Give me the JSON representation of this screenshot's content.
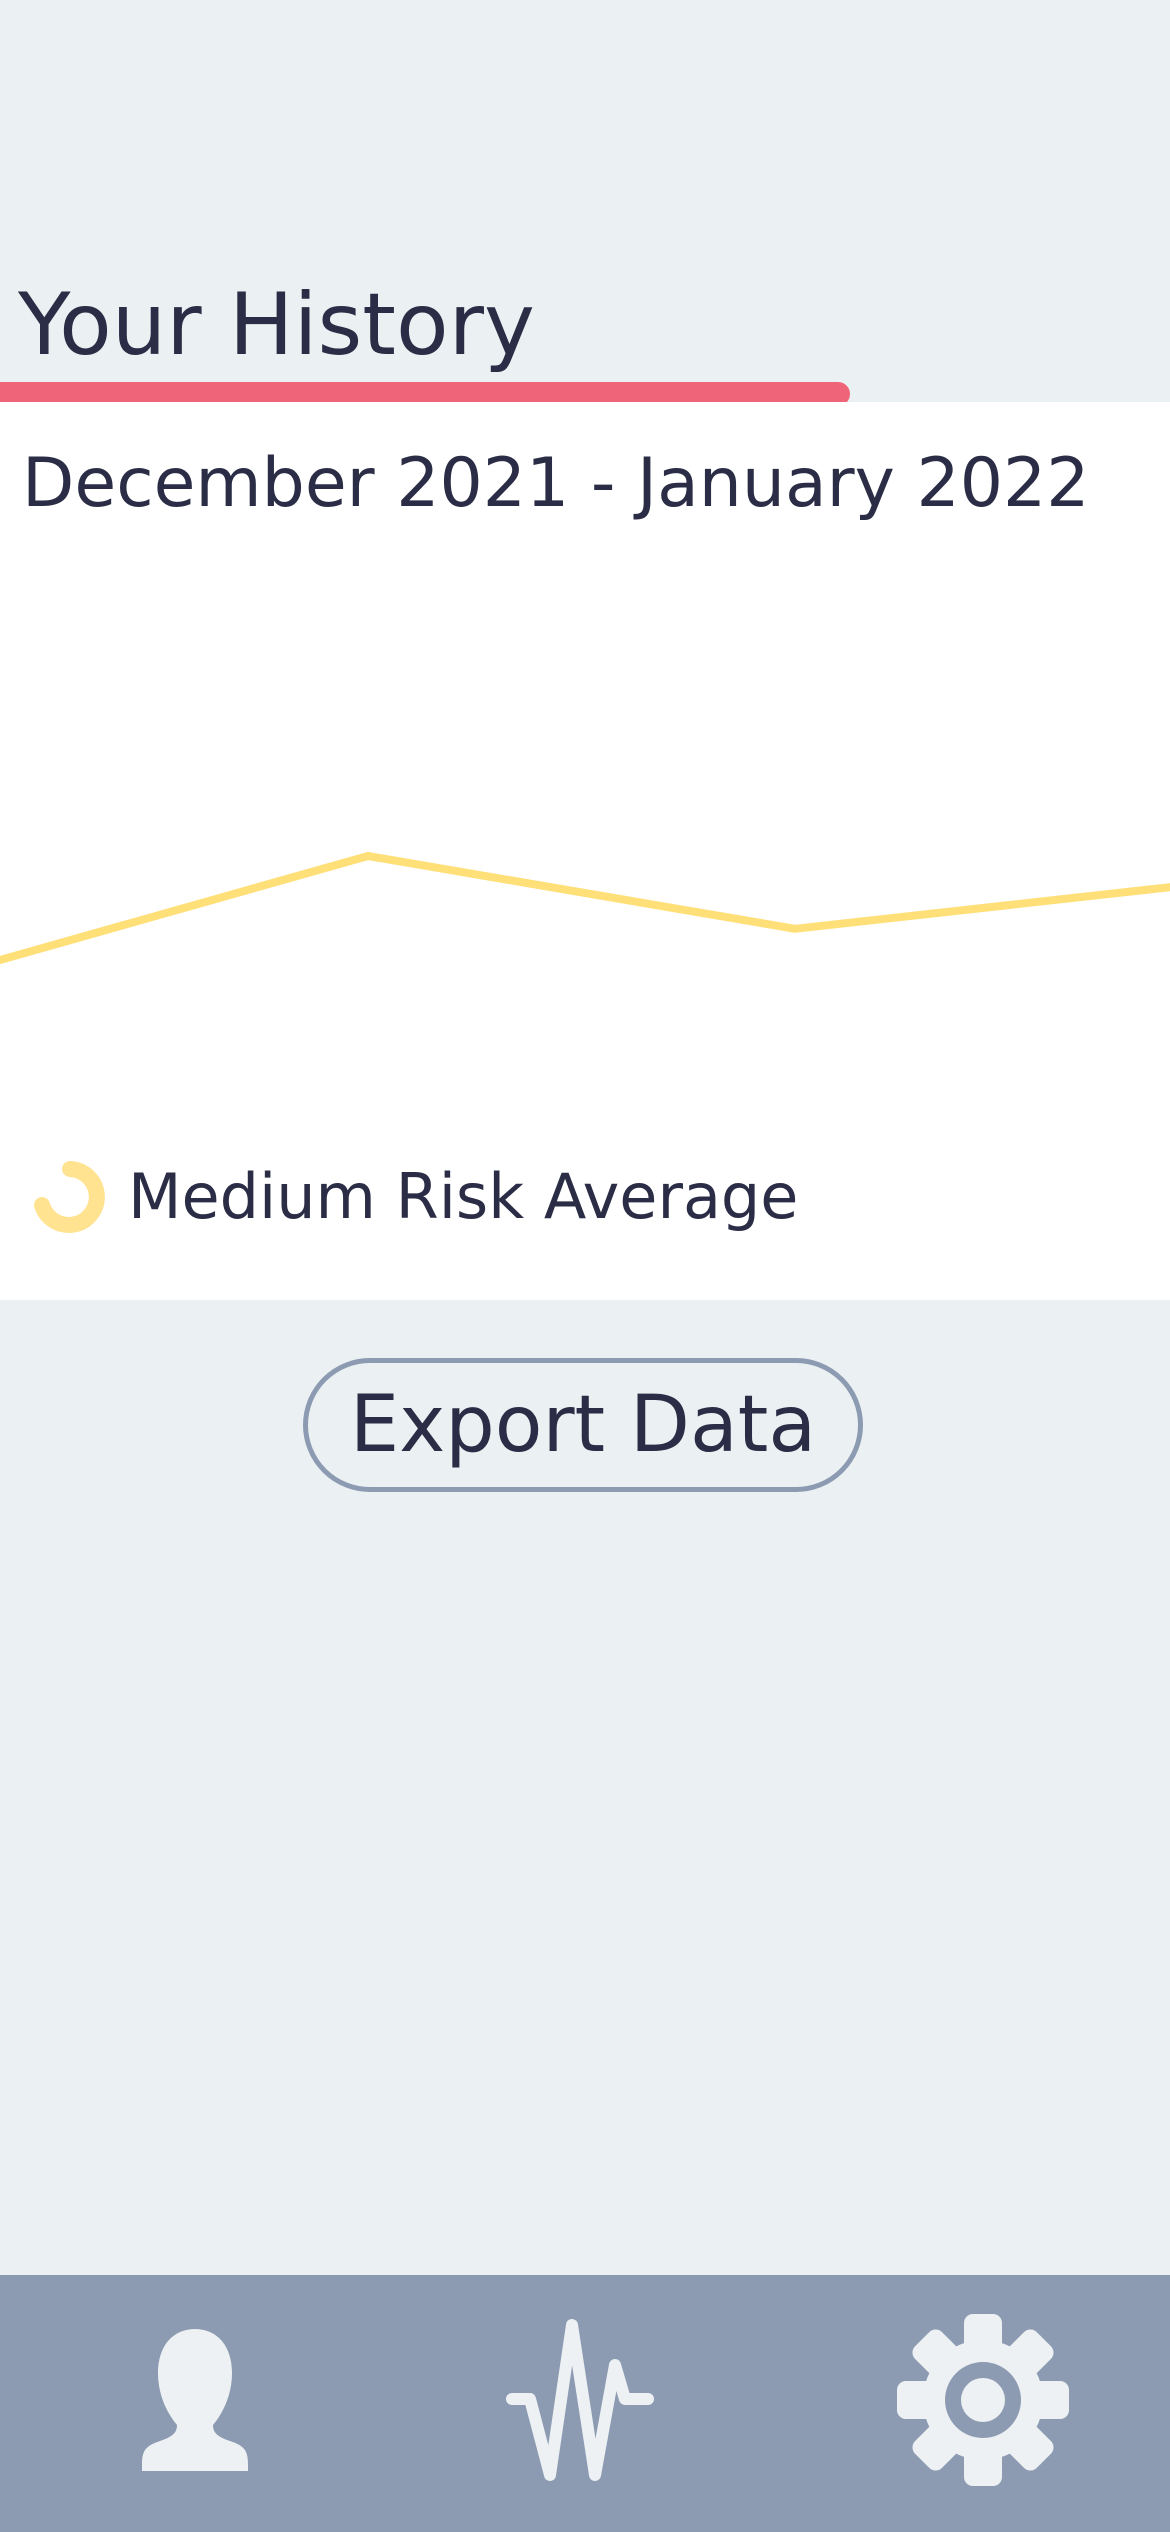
{
  "header": {
    "title": "Your History"
  },
  "history": {
    "date_range": "December 2021 - January 2022",
    "legend_label": "Medium Risk Average",
    "line_color": "#ffdf78"
  },
  "chart_data": {
    "type": "line",
    "series": [
      {
        "values": [
          0.2,
          0.6,
          0.32,
          0.48
        ]
      }
    ],
    "ylim": [
      0,
      1
    ],
    "grid": false
  },
  "actions": {
    "export_label": "Export Data"
  },
  "nav": {
    "items": [
      {
        "icon": "profile-icon"
      },
      {
        "icon": "activity-icon"
      },
      {
        "icon": "settings-icon"
      }
    ]
  },
  "colors": {
    "background": "#ebf0f3",
    "card": "#ffffff",
    "accent": "#ef6478",
    "nav_bar": "#8c9bb2",
    "nav_icon": "#eef1f4",
    "text": "#2a2d45"
  }
}
